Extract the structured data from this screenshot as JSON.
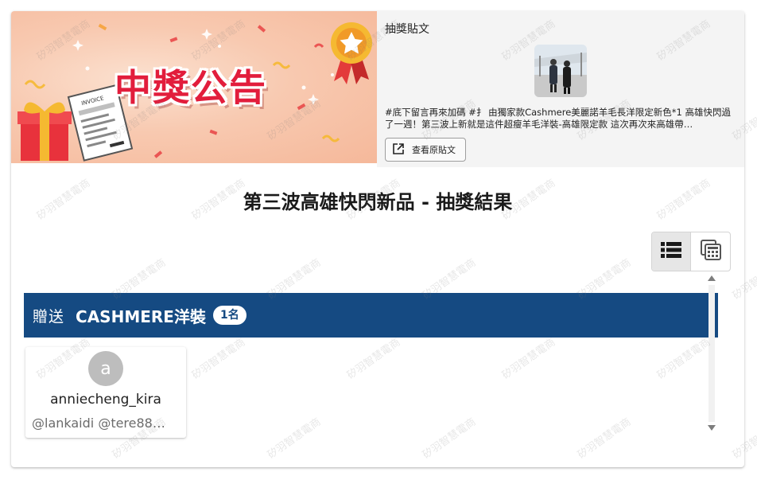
{
  "banner": {
    "title": "中獎公告",
    "invoice_label": "INVOICE",
    "colors": {
      "title": "#e21d3c",
      "background": "#f8c9b0"
    }
  },
  "post": {
    "heading": "抽獎貼文",
    "text": "#底下留言再來加碼 #扌 由獨家款Cashmere美麗諾羊毛長洋限定新色*1 高雄快閃過了一週！第三波上新就是這件超瘦羊毛洋裝-高雄限定款 這次再次來高雄帶…",
    "view_button_label": "查看原貼文",
    "view_button_icon": "open-in-new-icon"
  },
  "results": {
    "title": "第三波高雄快閃新品 - 抽獎結果",
    "view_toggle": {
      "list_icon": "list-view-icon",
      "grid_icon": "grid-view-icon",
      "active": "list"
    },
    "prize": {
      "label": "贈送",
      "name": "CASHMERE洋裝",
      "count": "1名",
      "color": "#154a82"
    },
    "winners": [
      {
        "avatar_letter": "a",
        "username": "anniecheng_kira",
        "tags": "@lankaidi @tere88…"
      }
    ]
  },
  "watermark": "矽羽智慧電商"
}
